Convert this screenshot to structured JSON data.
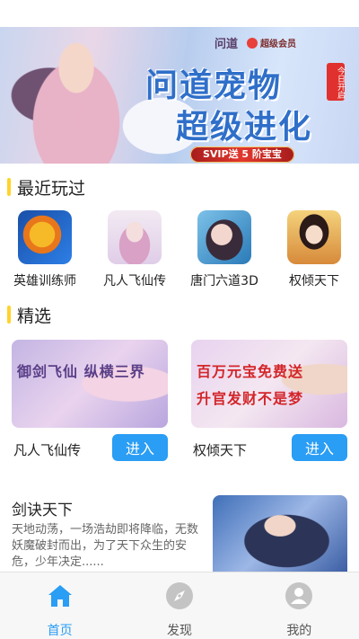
{
  "banner": {
    "logo_left": "问道",
    "logo_right": "超级会员",
    "title_line1": "问道宠物",
    "title_line2": "超级进化",
    "date_tag": "今日开启",
    "promo": "SVIP送 5 阶宝宝"
  },
  "recent": {
    "title": "最近玩过",
    "items": [
      {
        "label": "英雄训练师",
        "icon": "dragon-game-icon"
      },
      {
        "label": "凡人飞仙传",
        "icon": "fairy-game-icon"
      },
      {
        "label": "唐门六道3D",
        "icon": "tangmen-game-icon"
      },
      {
        "label": "权倾天下",
        "icon": "empress-game-icon"
      }
    ]
  },
  "featured": {
    "title": "精选",
    "cards": [
      {
        "name": "凡人飞仙传",
        "caption": "御剑飞仙 纵横三界",
        "caption2": "",
        "button": "进入"
      },
      {
        "name": "权倾天下",
        "caption": "百万元宝免费送",
        "caption2": "升官发财不是梦",
        "button": "进入"
      }
    ]
  },
  "article": {
    "title": "剑诀天下",
    "description": "天地动荡，一场浩劫即将降临，无数妖魔破封而出，为了天下众生的安危，少年决定......"
  },
  "tabs": [
    {
      "label": "首页",
      "icon": "home-icon",
      "active": true
    },
    {
      "label": "发现",
      "icon": "compass-icon",
      "active": false
    },
    {
      "label": "我的",
      "icon": "user-icon",
      "active": false
    }
  ],
  "colors": {
    "accent": "#2a9df4",
    "section_bar": "#ffd42a",
    "inactive_icon": "#c4c4c4"
  }
}
